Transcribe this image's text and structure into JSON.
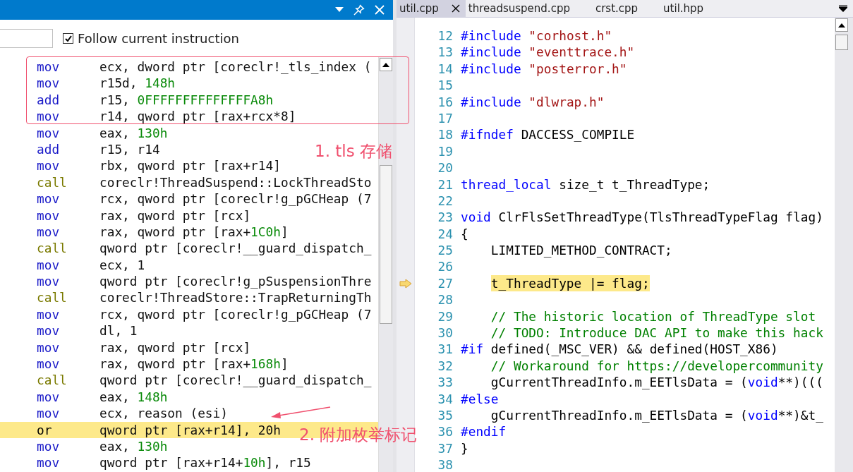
{
  "disassembly_panel": {
    "follow_current_instruction": {
      "label": "Follow current instruction",
      "checked": true
    },
    "lines": [
      {
        "mnemonic": "mov",
        "kind": "instruction",
        "current": false,
        "operands": [
          {
            "kind": "plain",
            "text": "ecx, dword ptr [coreclr!_tls_index ("
          }
        ]
      },
      {
        "mnemonic": "mov",
        "kind": "instruction",
        "current": false,
        "operands": [
          {
            "kind": "plain",
            "text": "r15d, "
          },
          {
            "kind": "number",
            "text": "148h"
          }
        ]
      },
      {
        "mnemonic": "add",
        "kind": "instruction",
        "current": false,
        "operands": [
          {
            "kind": "plain",
            "text": "r15, "
          },
          {
            "kind": "number",
            "text": "0FFFFFFFFFFFFFFA8h"
          }
        ]
      },
      {
        "mnemonic": "mov",
        "kind": "instruction",
        "current": false,
        "operands": [
          {
            "kind": "plain",
            "text": "r14, qword ptr [rax+rcx*8]"
          }
        ]
      },
      {
        "mnemonic": "mov",
        "kind": "instruction",
        "current": false,
        "operands": [
          {
            "kind": "plain",
            "text": "eax, "
          },
          {
            "kind": "number",
            "text": "130h"
          }
        ]
      },
      {
        "mnemonic": "add",
        "kind": "instruction",
        "current": false,
        "operands": [
          {
            "kind": "plain",
            "text": "r15, r14"
          }
        ]
      },
      {
        "mnemonic": "mov",
        "kind": "instruction",
        "current": false,
        "operands": [
          {
            "kind": "plain",
            "text": "rbx, qword ptr [rax+r14]"
          }
        ]
      },
      {
        "mnemonic": "call",
        "kind": "call",
        "current": false,
        "operands": [
          {
            "kind": "plain",
            "text": "coreclr!ThreadSuspend::LockThreadSto"
          }
        ]
      },
      {
        "mnemonic": "mov",
        "kind": "instruction",
        "current": false,
        "operands": [
          {
            "kind": "plain",
            "text": "rcx, qword ptr [coreclr!g_pGCHeap (7"
          }
        ]
      },
      {
        "mnemonic": "mov",
        "kind": "instruction",
        "current": false,
        "operands": [
          {
            "kind": "plain",
            "text": "rax, qword ptr [rcx]"
          }
        ]
      },
      {
        "mnemonic": "mov",
        "kind": "instruction",
        "current": false,
        "operands": [
          {
            "kind": "plain",
            "text": "rax, qword ptr [rax+"
          },
          {
            "kind": "number",
            "text": "1C0h"
          },
          {
            "kind": "plain",
            "text": "]"
          }
        ]
      },
      {
        "mnemonic": "call",
        "kind": "call",
        "current": false,
        "operands": [
          {
            "kind": "plain",
            "text": "qword ptr [coreclr!__guard_dispatch_"
          }
        ]
      },
      {
        "mnemonic": "mov",
        "kind": "instruction",
        "current": false,
        "operands": [
          {
            "kind": "plain",
            "text": "ecx, 1"
          }
        ]
      },
      {
        "mnemonic": "mov",
        "kind": "instruction",
        "current": false,
        "operands": [
          {
            "kind": "plain",
            "text": "qword ptr [coreclr!g_pSuspensionThre"
          }
        ]
      },
      {
        "mnemonic": "call",
        "kind": "call",
        "current": false,
        "operands": [
          {
            "kind": "plain",
            "text": "coreclr!ThreadStore::TrapReturningTh"
          }
        ]
      },
      {
        "mnemonic": "mov",
        "kind": "instruction",
        "current": false,
        "operands": [
          {
            "kind": "plain",
            "text": "rcx, qword ptr [coreclr!g_pGCHeap (7"
          }
        ]
      },
      {
        "mnemonic": "mov",
        "kind": "instruction",
        "current": false,
        "operands": [
          {
            "kind": "plain",
            "text": "dl, 1"
          }
        ]
      },
      {
        "mnemonic": "mov",
        "kind": "instruction",
        "current": false,
        "operands": [
          {
            "kind": "plain",
            "text": "rax, qword ptr [rcx]"
          }
        ]
      },
      {
        "mnemonic": "mov",
        "kind": "instruction",
        "current": false,
        "operands": [
          {
            "kind": "plain",
            "text": "rax, qword ptr [rax+"
          },
          {
            "kind": "number",
            "text": "168h"
          },
          {
            "kind": "plain",
            "text": "]"
          }
        ]
      },
      {
        "mnemonic": "call",
        "kind": "call",
        "current": false,
        "operands": [
          {
            "kind": "plain",
            "text": "qword ptr [coreclr!__guard_dispatch_"
          }
        ]
      },
      {
        "mnemonic": "mov",
        "kind": "instruction",
        "current": false,
        "operands": [
          {
            "kind": "plain",
            "text": "eax, "
          },
          {
            "kind": "number",
            "text": "148h"
          }
        ]
      },
      {
        "mnemonic": "mov",
        "kind": "instruction",
        "current": false,
        "operands": [
          {
            "kind": "plain",
            "text": "ecx, reason (esi)"
          }
        ]
      },
      {
        "mnemonic": "or",
        "kind": "instruction",
        "current": true,
        "operands": [
          {
            "kind": "plain",
            "text": "qword ptr [rax+r14], 20h"
          }
        ]
      },
      {
        "mnemonic": "mov",
        "kind": "instruction",
        "current": false,
        "operands": [
          {
            "kind": "plain",
            "text": "eax, "
          },
          {
            "kind": "number",
            "text": "130h"
          }
        ]
      },
      {
        "mnemonic": "mov",
        "kind": "instruction",
        "current": false,
        "operands": [
          {
            "kind": "plain",
            "text": "qword ptr [rax+r14+"
          },
          {
            "kind": "number",
            "text": "10h"
          },
          {
            "kind": "plain",
            "text": "], r15"
          }
        ]
      }
    ]
  },
  "editor": {
    "tabs": [
      {
        "label": "util.cpp",
        "selected": true
      },
      {
        "label": "threadsuspend.cpp",
        "selected": false
      },
      {
        "label": "crst.cpp",
        "selected": false
      },
      {
        "label": "util.hpp",
        "selected": false
      }
    ],
    "lines": [
      {
        "number": "12",
        "current": false,
        "indented": false,
        "segments": [
          {
            "kind": "keyword",
            "text": "#include"
          },
          {
            "kind": "string",
            "text": " \"corhost.h\""
          }
        ]
      },
      {
        "number": "13",
        "current": false,
        "indented": false,
        "segments": [
          {
            "kind": "keyword",
            "text": "#include"
          },
          {
            "kind": "string",
            "text": " \"eventtrace.h\""
          }
        ]
      },
      {
        "number": "14",
        "current": false,
        "indented": false,
        "segments": [
          {
            "kind": "keyword",
            "text": "#include"
          },
          {
            "kind": "string",
            "text": " \"posterror.h\""
          }
        ]
      },
      {
        "number": "15",
        "current": false
      },
      {
        "number": "16",
        "current": false,
        "indented": false,
        "segments": [
          {
            "kind": "keyword",
            "text": "#include"
          },
          {
            "kind": "string",
            "text": " \"dlwrap.h\""
          }
        ]
      },
      {
        "number": "17",
        "current": false
      },
      {
        "number": "18",
        "current": false,
        "indented": false,
        "segments": [
          {
            "kind": "keyword",
            "text": "#ifndef"
          },
          {
            "kind": "plain",
            "text": " DACCESS_COMPILE"
          }
        ]
      },
      {
        "number": "19",
        "current": false
      },
      {
        "number": "20",
        "current": false
      },
      {
        "number": "21",
        "current": false,
        "indented": false,
        "segments": [
          {
            "kind": "keyword",
            "text": "thread_local"
          },
          {
            "kind": "plain",
            "text": " size_t t_ThreadType;"
          }
        ]
      },
      {
        "number": "22",
        "current": false
      },
      {
        "number": "23",
        "current": false,
        "indented": false,
        "segments": [
          {
            "kind": "keyword",
            "text": "void"
          },
          {
            "kind": "plain",
            "text": " ClrFlsSetThreadType(TlsThreadTypeFlag flag)"
          }
        ]
      },
      {
        "number": "24",
        "current": false,
        "indented": false,
        "segments": [
          {
            "kind": "plain",
            "text": "{"
          }
        ]
      },
      {
        "number": "25",
        "current": false,
        "indented": true,
        "segments": [
          {
            "kind": "plain",
            "text": "LIMITED_METHOD_CONTRACT;"
          }
        ]
      },
      {
        "number": "26",
        "current": false
      },
      {
        "number": "27",
        "current": true,
        "indented": true,
        "segments": [
          {
            "kind": "plain",
            "text": "t_ThreadType |= flag;"
          }
        ]
      },
      {
        "number": "28",
        "current": false
      },
      {
        "number": "29",
        "current": false,
        "indented": true,
        "segments": [
          {
            "kind": "comment",
            "text": "// The historic location of ThreadType slot"
          }
        ]
      },
      {
        "number": "30",
        "current": false,
        "indented": true,
        "segments": [
          {
            "kind": "comment",
            "text": "// TODO: Introduce DAC API to make this hack"
          }
        ]
      },
      {
        "number": "31",
        "current": false,
        "indented": false,
        "segments": [
          {
            "kind": "keyword",
            "text": "#if"
          },
          {
            "kind": "plain",
            "text": " defined(_MSC_VER) && defined(HOST_X86)"
          }
        ]
      },
      {
        "number": "32",
        "current": false,
        "indented": true,
        "segments": [
          {
            "kind": "comment",
            "text": "// Workaround for https://developercommunity"
          }
        ]
      },
      {
        "number": "33",
        "current": false,
        "indented": true,
        "segments": [
          {
            "kind": "plain",
            "text": "gCurrentThreadInfo.m_EETlsData = ("
          },
          {
            "kind": "keyword",
            "text": "void"
          },
          {
            "kind": "plain",
            "text": "**)((("
          }
        ]
      },
      {
        "number": "34",
        "current": false,
        "indented": false,
        "segments": [
          {
            "kind": "keyword",
            "text": "#else"
          }
        ]
      },
      {
        "number": "35",
        "current": false,
        "indented": true,
        "segments": [
          {
            "kind": "plain",
            "text": "gCurrentThreadInfo.m_EETlsData = ("
          },
          {
            "kind": "keyword",
            "text": "void"
          },
          {
            "kind": "plain",
            "text": "**)&t_"
          }
        ]
      },
      {
        "number": "36",
        "current": false,
        "indented": false,
        "segments": [
          {
            "kind": "keyword",
            "text": "#endif"
          }
        ]
      },
      {
        "number": "37",
        "current": false,
        "indented": false,
        "segments": [
          {
            "kind": "plain",
            "text": "}"
          }
        ]
      },
      {
        "number": "38",
        "current": false
      }
    ]
  },
  "annotations": [
    {
      "kind": "box"
    },
    {
      "kind": "label",
      "text": "1. tls 存储"
    },
    {
      "kind": "arrow"
    },
    {
      "kind": "label",
      "text": "2. 附加枚举标记"
    }
  ]
}
